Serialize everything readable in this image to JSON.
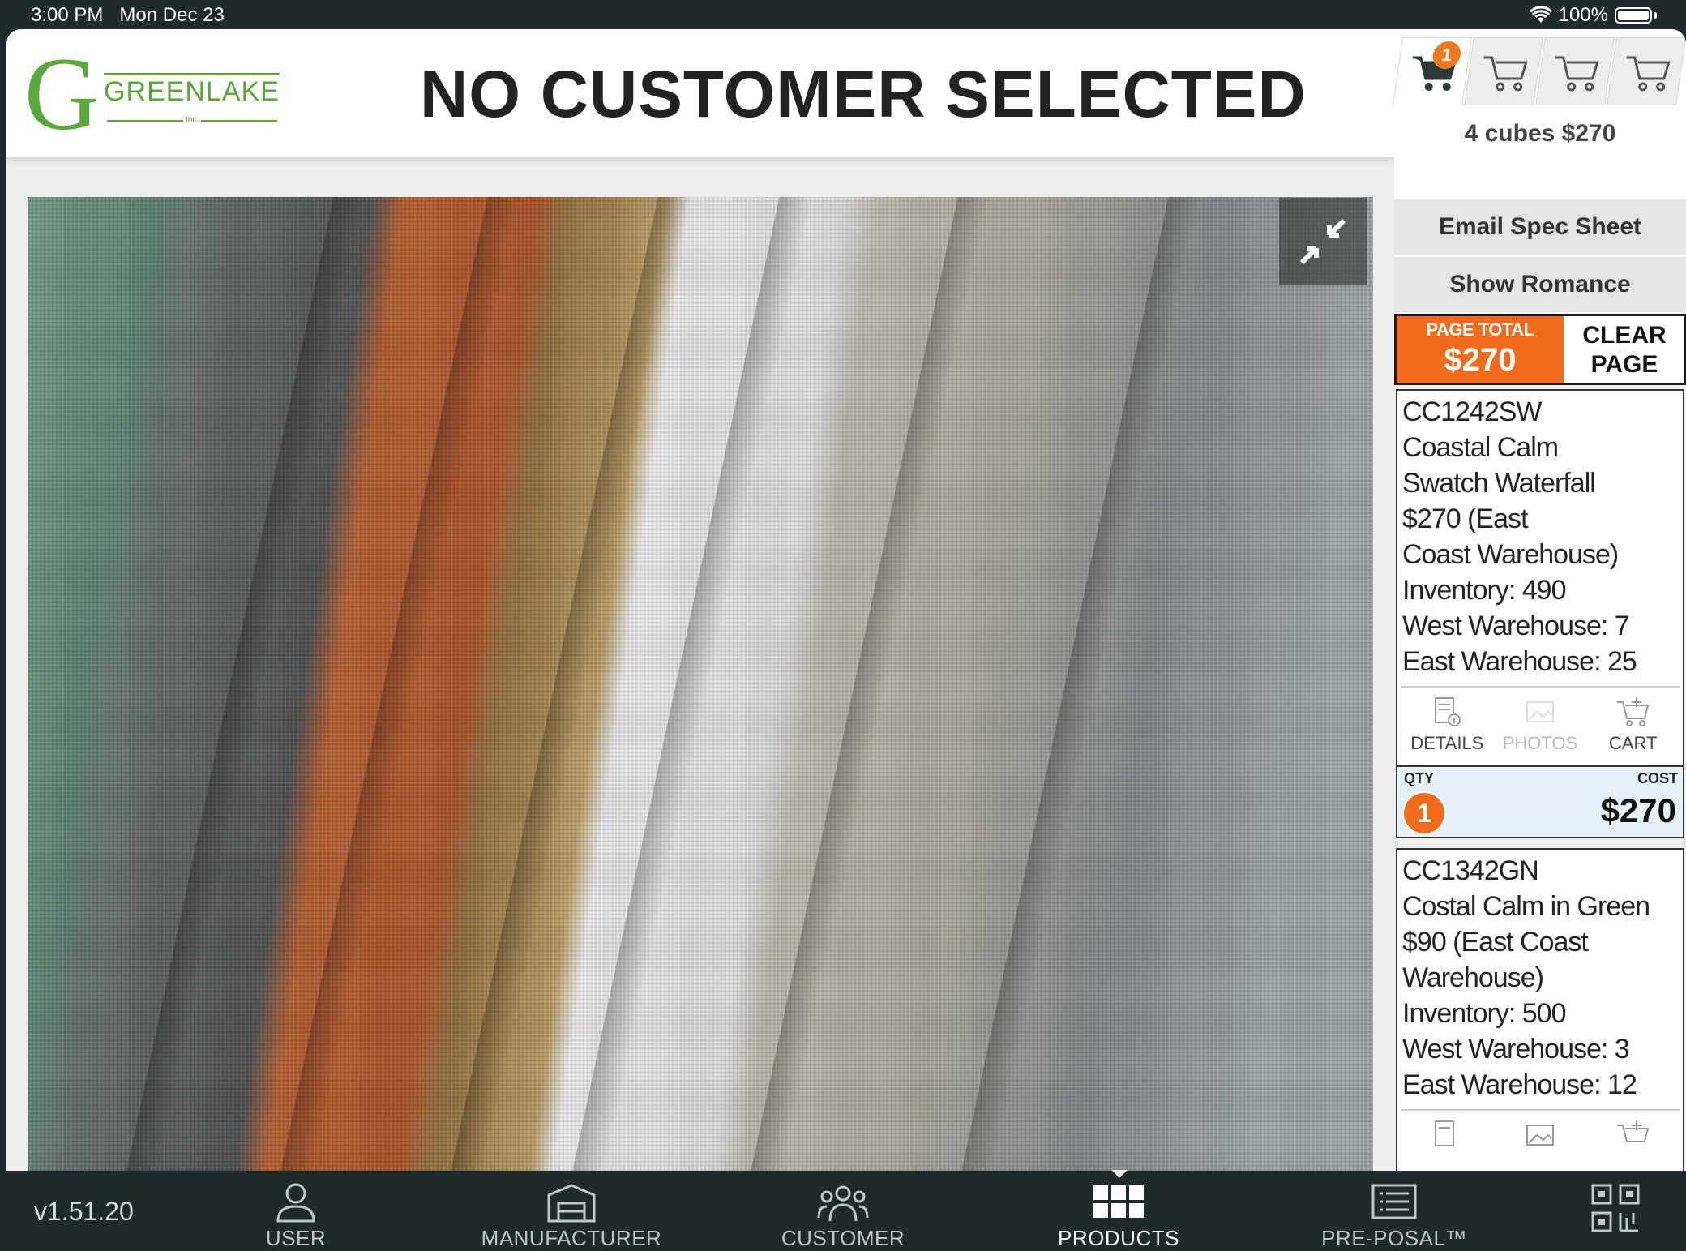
{
  "status_bar": {
    "time": "3:00 PM",
    "date": "Mon Dec 23",
    "battery": "100%"
  },
  "logo": {
    "letter": "G",
    "word": "GREENLAKE",
    "inc": "Inc."
  },
  "header": {
    "title": "NO CUSTOMER SELECTED"
  },
  "cart": {
    "tab_badge": "1",
    "summary": "4 cubes $270",
    "tabs": [
      "cart-1",
      "cart-2",
      "cart-3",
      "cart-4"
    ]
  },
  "buttons": {
    "email_spec_sheet": "Email Spec Sheet",
    "show_romance": "Show Romance",
    "page_total_label": "PAGE TOTAL",
    "page_total_amount": "$270",
    "clear_line1": "CLEAR",
    "clear_line2": "PAGE"
  },
  "products": [
    {
      "lines": [
        "CC1242SW",
        "Coastal Calm",
        "Swatch Waterfall",
        "$270 (East",
        "Coast Warehouse)",
        "Inventory: 490",
        "West Warehouse: 7",
        "East Warehouse: 25"
      ],
      "actions": {
        "details": "DETAILS",
        "photos": "PHOTOS",
        "cart": "CART"
      },
      "qty_label": "QTY",
      "cost_label": "COST",
      "qty": "1",
      "cost": "$270"
    },
    {
      "lines": [
        "CC1342GN",
        "Costal Calm in Green",
        "$90 (East Coast",
        "Warehouse)",
        "Inventory: 500",
        "West Warehouse: 3",
        "East Warehouse: 12"
      ]
    }
  ],
  "bottom_nav": {
    "version": "v1.51.20",
    "items": [
      "USER",
      "MANUFACTURER",
      "CUSTOMER",
      "PRODUCTS",
      "PRE-POSAL™"
    ]
  },
  "colors": {
    "accent_orange": "#f26a1b",
    "brand_green": "#58a83a",
    "nav_bg": "#1e2b2c"
  }
}
